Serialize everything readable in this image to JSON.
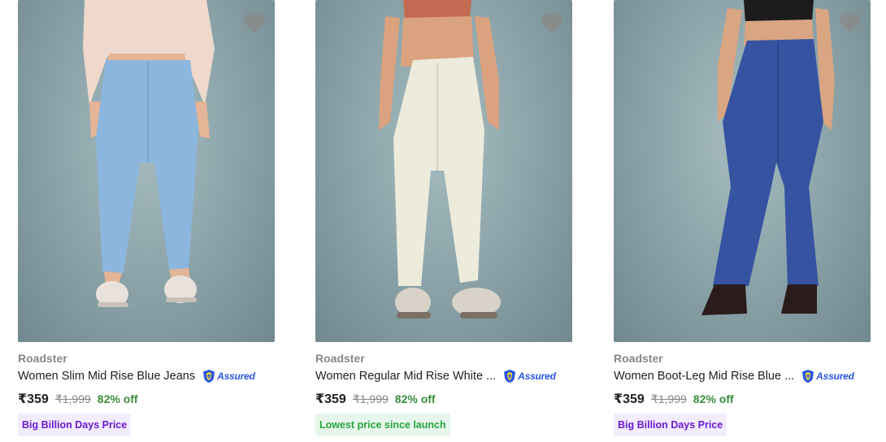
{
  "products": [
    {
      "brand": "Roadster",
      "title": "Women Slim Mid Rise Blue Jeans",
      "assured_label": "Assured",
      "price": "₹359",
      "mrp": "₹1,999",
      "discount": "82% off",
      "badge": "Big Billion Days Price",
      "badge_type": "bbd",
      "image": "model-wearing-light-blue-slim-jeans",
      "jeans_color": "#8db6de",
      "top_color": "#eed9cc",
      "shoe_color": "#e9e2dc"
    },
    {
      "brand": "Roadster",
      "title": "Women Regular Mid Rise White ...",
      "assured_label": "Assured",
      "price": "₹359",
      "mrp": "₹1,999",
      "discount": "82% off",
      "badge": "Lowest price since launch",
      "badge_type": "low",
      "image": "model-wearing-white-regular-jeans",
      "jeans_color": "#ecebdc",
      "top_color": "#c56a52",
      "shoe_color": "#d8d2c8"
    },
    {
      "brand": "Roadster",
      "title": "Women Boot-Leg Mid Rise Blue ...",
      "assured_label": "Assured",
      "price": "₹359",
      "mrp": "₹1,999",
      "discount": "82% off",
      "badge": "Big Billion Days Price",
      "badge_type": "bbd",
      "image": "model-wearing-blue-bootleg-jeans",
      "jeans_color": "#3553a1",
      "top_color": "#1c1c1c",
      "shoe_color": "#2a1c1a"
    }
  ],
  "colors": {
    "brand_text": "#878787",
    "discount_green": "#388e3c",
    "assured_blue": "#2a55e5",
    "wishlist_icon": "#8a8a8a"
  }
}
